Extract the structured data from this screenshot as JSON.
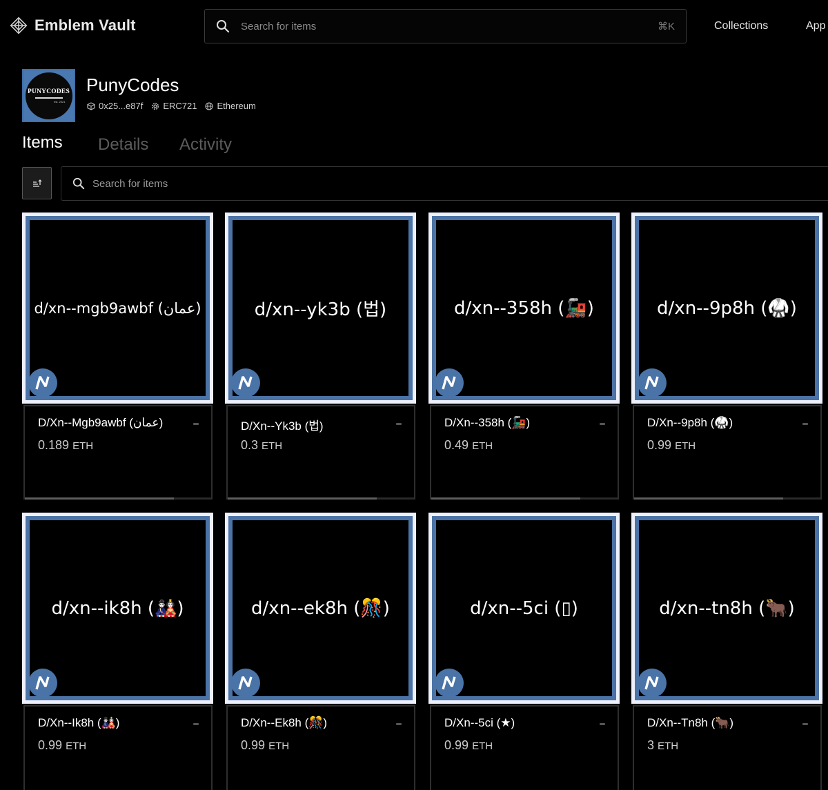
{
  "nav": {
    "brand": "Emblem Vault",
    "search_placeholder": "Search for items",
    "search_shortcut": "⌘K",
    "links": [
      "Collections",
      "App"
    ]
  },
  "collection": {
    "avatar_text": "PUNYCODES",
    "avatar_est": "est. 2021",
    "name": "PunyCodes",
    "address": "0x25...e87f",
    "standard": "ERC721",
    "chain": "Ethereum"
  },
  "tabs": [
    {
      "label": "Items",
      "active": true
    },
    {
      "label": "Details",
      "active": false
    },
    {
      "label": "Activity",
      "active": false
    }
  ],
  "filters": {
    "search_placeholder": "Search for items"
  },
  "items": [
    {
      "image_text": "d/xn--mgb9awbf (عمان)",
      "name": "D/Xn--Mgb9awbf (عمان)",
      "price": "0.189",
      "currency": "ETH"
    },
    {
      "image_text": "d/xn--yk3b (법)",
      "name": "D/Xn--Yk3b (법)",
      "price": "0.3",
      "currency": "ETH"
    },
    {
      "image_text": "d/xn--358h (🚂)",
      "name": "D/Xn--358h (🚂)",
      "price": "0.49",
      "currency": "ETH"
    },
    {
      "image_text": "d/xn--9p8h (🥋)",
      "name": "D/Xn--9p8h (🥋)",
      "price": "0.99",
      "currency": "ETH"
    },
    {
      "image_text": "d/xn--ik8h (🎎)",
      "name": "D/Xn--Ik8h (🎎)",
      "price": "0.99",
      "currency": "ETH"
    },
    {
      "image_text": "d/xn--ek8h (🎊)",
      "name": "D/Xn--Ek8h (🎊)",
      "price": "0.99",
      "currency": "ETH"
    },
    {
      "image_text": "d/xn--5ci (▯)",
      "name": "D/Xn--5ci (★)",
      "price": "0.99",
      "currency": "ETH"
    },
    {
      "image_text": "d/xn--tn8h (🐂)",
      "name": "D/Xn--Tn8h (🐂)",
      "price": "3",
      "currency": "ETH"
    }
  ],
  "colors": {
    "card_frame": "#4b73a6",
    "card_outer": "#eef0fb",
    "badge": "#4a74a8"
  }
}
